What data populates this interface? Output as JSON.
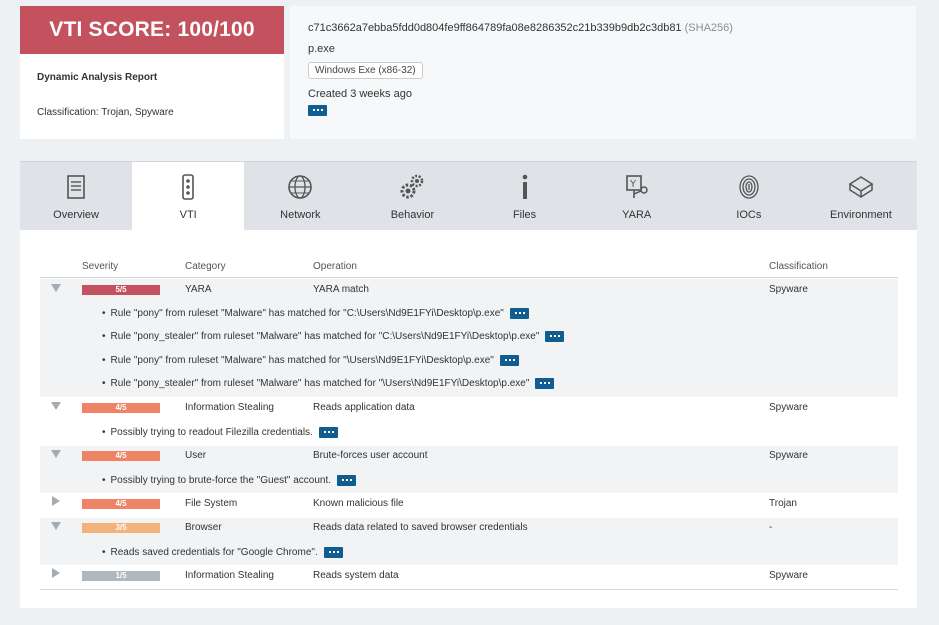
{
  "score": {
    "banner": "VTI SCORE: 100/100",
    "title": "Dynamic Analysis Report",
    "classification": "Classification: Trojan, Spyware"
  },
  "file": {
    "hash": "c71c3662a7ebba5fdd0d804fe9ff864789fa08e8286352c21b339b9db2c3db81",
    "hash_type": "(SHA256)",
    "name": "p.exe",
    "type": "Windows Exe (x86-32)",
    "created": "Created 3 weeks ago"
  },
  "tabs": [
    {
      "label": "Overview",
      "icon": "document-icon"
    },
    {
      "label": "VTI",
      "icon": "traffic-light-icon"
    },
    {
      "label": "Network",
      "icon": "globe-icon"
    },
    {
      "label": "Behavior",
      "icon": "gears-icon"
    },
    {
      "label": "Files",
      "icon": "info-icon"
    },
    {
      "label": "YARA",
      "icon": "yara-icon"
    },
    {
      "label": "IOCs",
      "icon": "fingerprint-icon"
    },
    {
      "label": "Environment",
      "icon": "cube-icon"
    }
  ],
  "active_tab": "VTI",
  "table": {
    "headers": {
      "severity": "Severity",
      "category": "Category",
      "operation": "Operation",
      "classification": "Classification"
    },
    "rows": [
      {
        "severity": "5/5",
        "color": "#c4525e",
        "expanded": true,
        "category": "YARA",
        "operation": "YARA match",
        "classification": "Spyware",
        "details": [
          "Rule \"pony\" from ruleset \"Malware\" has matched for \"C:\\Users\\Nd9E1FYi\\Desktop\\p.exe\"",
          "Rule \"pony_stealer\" from ruleset \"Malware\" has matched for \"C:\\Users\\Nd9E1FYi\\Desktop\\p.exe\"",
          "Rule \"pony\" from ruleset \"Malware\" has matched for \"\\Users\\Nd9E1FYi\\Desktop\\p.exe\"",
          "Rule \"pony_stealer\" from ruleset \"Malware\" has matched for \"\\Users\\Nd9E1FYi\\Desktop\\p.exe\""
        ]
      },
      {
        "severity": "4/5",
        "color": "#ee8465",
        "expanded": true,
        "category": "Information Stealing",
        "operation": "Reads application data",
        "classification": "Spyware",
        "details": [
          "Possibly trying to readout Filezilla credentials."
        ]
      },
      {
        "severity": "4/5",
        "color": "#ee8465",
        "expanded": true,
        "category": "User",
        "operation": "Brute-forces user account",
        "classification": "Spyware",
        "details": [
          "Possibly trying to brute-force the \"Guest\" account."
        ]
      },
      {
        "severity": "4/5",
        "color": "#ee8465",
        "expanded": false,
        "category": "File System",
        "operation": "Known malicious file",
        "classification": "Trojan",
        "details": []
      },
      {
        "severity": "3/5",
        "color": "#f2b27a",
        "expanded": true,
        "category": "Browser",
        "operation": "Reads data related to saved browser credentials",
        "classification": "-",
        "details": [
          "Reads saved credentials for \"Google Chrome\"."
        ]
      },
      {
        "severity": "1/5",
        "color": "#b0b7bd",
        "expanded": false,
        "category": "Information Stealing",
        "operation": "Reads system data",
        "classification": "Spyware",
        "details": []
      }
    ]
  }
}
